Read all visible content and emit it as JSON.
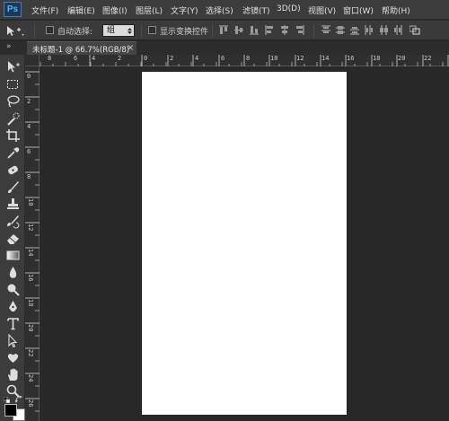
{
  "app": {
    "logo": "Ps"
  },
  "menu": {
    "items": [
      "文件(F)",
      "编辑(E)",
      "图像(I)",
      "图层(L)",
      "文字(Y)",
      "选择(S)",
      "滤镜(T)",
      "3D(D)",
      "视图(V)",
      "窗口(W)",
      "帮助(H)"
    ]
  },
  "options": {
    "auto_select_label": "自动选择:",
    "auto_select_value": "组",
    "show_transform_label": "显示变换控件"
  },
  "document": {
    "tab_title": "未标题-1 @ 66.7%(RGB/8)",
    "close_glyph": "×"
  },
  "toolbar": {
    "collapse_glyph": "»",
    "tools": [
      "move-tool-icon",
      "marquee-tool-icon",
      "lasso-tool-icon",
      "quick-select-tool-icon",
      "crop-tool-icon",
      "eyedropper-tool-icon",
      "healing-brush-tool-icon",
      "brush-tool-icon",
      "clone-stamp-tool-icon",
      "history-brush-tool-icon",
      "eraser-tool-icon",
      "gradient-tool-icon",
      "blur-tool-icon",
      "dodge-tool-icon",
      "pen-tool-icon",
      "type-tool-icon",
      "path-selection-tool-icon",
      "custom-shape-tool-icon",
      "hand-tool-icon",
      "zoom-tool-icon"
    ]
  },
  "ruler": {
    "top_labels": [
      "0",
      "2",
      "4",
      "6",
      "8",
      "10",
      "12",
      "14",
      "16",
      "18",
      "20",
      "22",
      "24",
      "26",
      "28",
      "30",
      "32",
      "34",
      "36"
    ],
    "top_labels_left": [
      "8",
      "6",
      "4",
      "2"
    ],
    "left_labels": [
      "0",
      "2",
      "4",
      "6",
      "8",
      "10",
      "12",
      "14",
      "16",
      "18",
      "20",
      "22",
      "24",
      "26"
    ]
  },
  "colors": {
    "menubar_bg": "#3c3c3c",
    "workspace_bg": "#282828",
    "canvas_bg": "#ffffff",
    "ps_accent": "#4fb3ff"
  }
}
